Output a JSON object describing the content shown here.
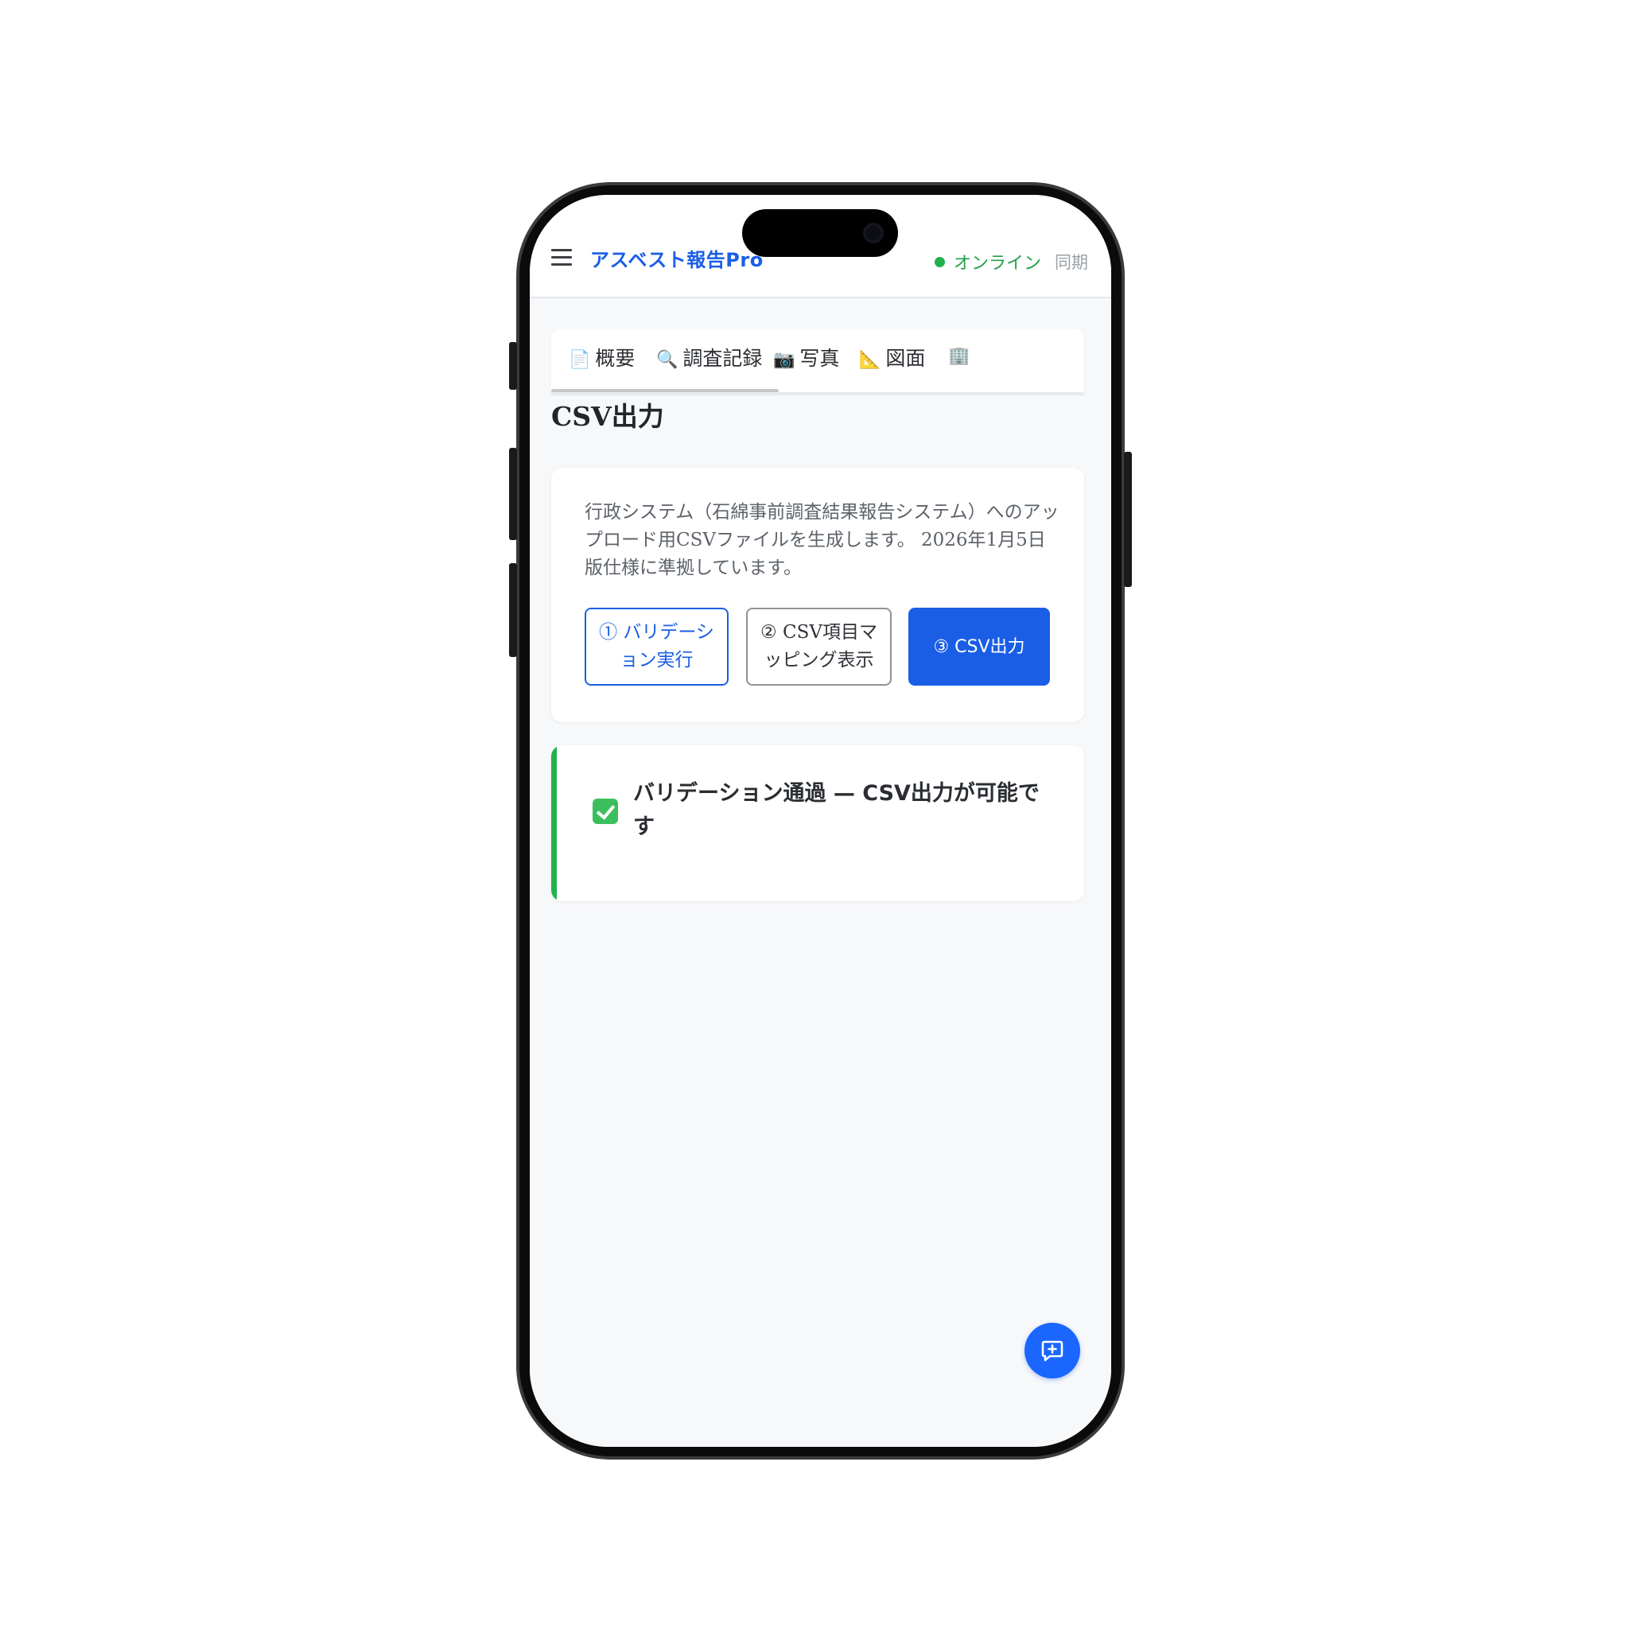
{
  "header": {
    "title": "アスベスト報告Pro",
    "status": "オンライン",
    "sync": "同期"
  },
  "tabs": [
    {
      "icon": "📄",
      "label": "概要"
    },
    {
      "icon": "🔍",
      "label": "調査記録"
    },
    {
      "icon": "📷",
      "label": "写真"
    },
    {
      "icon": "📐",
      "label": "図面"
    },
    {
      "icon": "🏢",
      "label": ""
    }
  ],
  "page": {
    "title": "CSV出力",
    "description": "行政システム（石綿事前調査結果報告システム）へのアップロード用CSVファイルを生成します。 2026年1月5日版仕様に準拠しています。"
  },
  "buttons": {
    "validate": "① バリデーション実行",
    "mapping": "② CSV項目マッピング表示",
    "export": "③ CSV出力"
  },
  "result": {
    "message": "バリデーション通過 — CSV出力が可能です"
  },
  "colors": {
    "accent": "#1a5ee6",
    "success": "#22b14c"
  },
  "icons": {
    "menu": "hamburger-menu-icon",
    "fab": "comment-plus-icon",
    "result": "check-icon"
  }
}
